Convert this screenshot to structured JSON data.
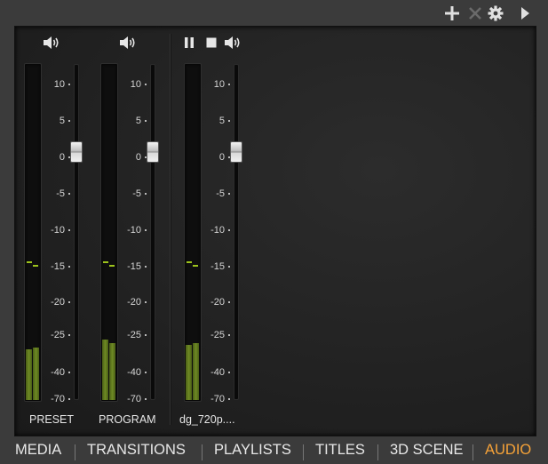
{
  "toolbar": {
    "icons": [
      "add-icon",
      "close-icon",
      "gear-icon",
      "play-arrow-icon"
    ]
  },
  "mixer": {
    "scale": [
      "10",
      "5",
      "0",
      "-5",
      "-10",
      "-15",
      "-20",
      "-25",
      "-40",
      "-70"
    ],
    "strips": [
      {
        "label": "PRESET",
        "controls": [
          "speaker-icon"
        ],
        "level_db": [
          "-38",
          "-38"
        ]
      },
      {
        "label": "PROGRAM",
        "controls": [
          "speaker-icon"
        ],
        "level_db": [
          "-36",
          "-37"
        ]
      },
      {
        "label": "dg_720p....",
        "controls": [
          "pause-icon",
          "stop-icon",
          "speaker-icon"
        ],
        "level_db": [
          "-37",
          "-37"
        ]
      }
    ]
  },
  "tabs": {
    "items": [
      "MEDIA",
      "TRANSITIONS",
      "PLAYLISTS",
      "TITLES",
      "3D SCENE",
      "AUDIO"
    ],
    "active": "AUDIO"
  },
  "colors": {
    "accent": "#f7a338",
    "meter": "#6e8a24",
    "peak": "#9cc21c"
  }
}
